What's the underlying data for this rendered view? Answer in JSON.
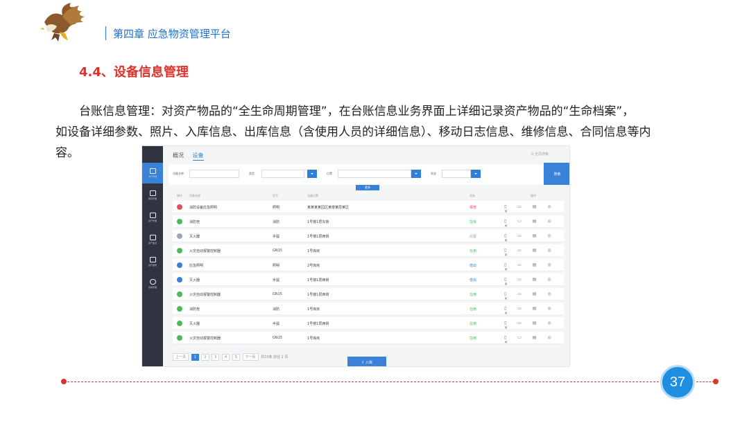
{
  "header": {
    "chapter_title": "第四章  应急物资管理平台"
  },
  "section": {
    "heading": "4.4、设备信息管理"
  },
  "body": {
    "line1": "台账信息管理：对资产物品的“全生命周期管理”，在台账信息业务界面上详细记录资产物品的“生命档案”，",
    "line2": "如设备详细参数、照片、入库信息、出库信息（含使用人员的详细信息）、移动日志信息、维修信息、合同信息等内",
    "line3": "容。"
  },
  "screenshot": {
    "tabs": [
      "概况",
      "设备"
    ],
    "search_placeholder": "Q 全局搜索",
    "sidebar": [
      "资产管理",
      "库存管理",
      "资产管理",
      "资产盘点",
      "资产报修",
      "系统管理"
    ],
    "filters": {
      "name_label": "设备名称",
      "type_label": "类型",
      "location_label": "位置",
      "status_label": "状态",
      "search_button": "搜索",
      "more_button": "更多"
    },
    "columns": [
      "操作",
      "设备名称",
      "型号",
      "设备位置",
      "状态",
      "操作"
    ],
    "rows": [
      {
        "name": "消防设备应急照明",
        "model": "照明",
        "location": "某某某某园区某楼某层某区",
        "status": "报修",
        "dot": "#e0505a",
        "status_color": "#e0505a"
      },
      {
        "name": "消防栓",
        "model": "消防",
        "location": "1号楼1层东侧",
        "status": "在库",
        "dot": "#4cb85c",
        "status_color": "#4cb85c"
      },
      {
        "name": "灭火器",
        "model": "手提",
        "location": "1号楼1层西侧",
        "status": "闲置",
        "dot": "#9aa6b8",
        "status_color": "#9aa6b8"
      },
      {
        "name": "火灾自动报警控制器",
        "model": "GN15",
        "location": "1号库房",
        "status": "在用",
        "dot": "#4cb85c",
        "status_color": "#4cb85c"
      },
      {
        "name": "应急照明",
        "model": "照明",
        "location": "2号库房",
        "status": "借出",
        "dot": "#3a82d8",
        "status_color": "#3a82d8"
      },
      {
        "name": "灭火器",
        "model": "手提",
        "location": "1号楼1层西侧",
        "status": "借出",
        "dot": "#3a82d8",
        "status_color": "#3a82d8"
      },
      {
        "name": "火灾自动报警控制器",
        "model": "GN15",
        "location": "1号楼1层西侧",
        "status": "在用",
        "dot": "#4cb85c",
        "status_color": "#4cb85c"
      },
      {
        "name": "消防栓",
        "model": "消防",
        "location": "1号库房",
        "status": "在用",
        "dot": "#4cb85c",
        "status_color": "#4cb85c"
      },
      {
        "name": "灭火器",
        "model": "手提",
        "location": "1号楼1层西侧",
        "status": "在用",
        "dot": "#4cb85c",
        "status_color": "#4cb85c"
      },
      {
        "name": "火灾自动报警控制器",
        "model": "GN15",
        "location": "1号库房",
        "status": "在用",
        "dot": "#4cb85c",
        "status_color": "#4cb85c"
      }
    ],
    "row_ops": "▯ ▭ ▤ ◎ ✕",
    "pager": {
      "prev": "上一页",
      "pages": [
        "1",
        "2",
        "3",
        "4",
        "5"
      ],
      "next": "下一页",
      "total": "共10条",
      "goto": "前往 2 页"
    },
    "import_button": "⇪ 入库"
  },
  "footer": {
    "page_number": "37"
  },
  "colors": {
    "accent_blue": "#1e8ee0",
    "heading_red": "#e0302a",
    "rule_red": "#d7382e"
  }
}
